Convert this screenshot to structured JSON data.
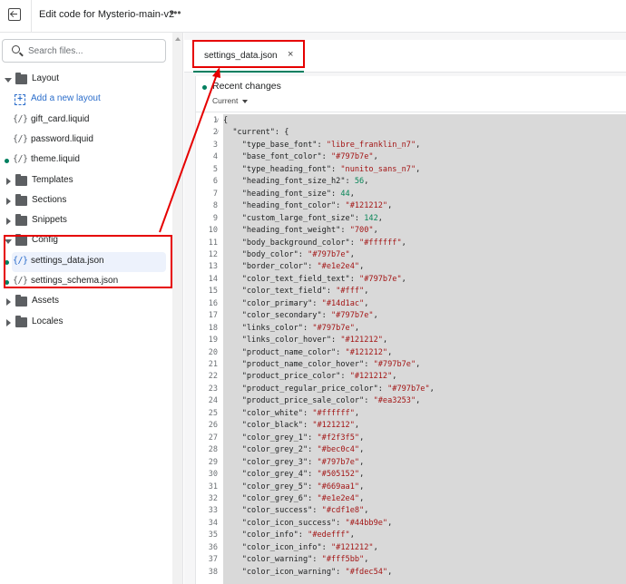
{
  "topbar": {
    "title": "Edit code for Mysterio-main-v2",
    "more_label": "•••",
    "back_icon": "exit-icon"
  },
  "sidebar": {
    "search_placeholder": "Search files...",
    "tree": [
      {
        "type": "folder",
        "label": "Layout",
        "expanded": true
      },
      {
        "type": "add",
        "label": "Add a new layout",
        "icon": "{+}"
      },
      {
        "type": "file",
        "label": "gift_card.liquid",
        "icon": "{/}",
        "modified": false
      },
      {
        "type": "file",
        "label": "password.liquid",
        "icon": "{/}",
        "modified": false
      },
      {
        "type": "file",
        "label": "theme.liquid",
        "icon": "{/}",
        "modified": true
      },
      {
        "type": "folder",
        "label": "Templates",
        "expanded": false
      },
      {
        "type": "folder",
        "label": "Sections",
        "expanded": false
      },
      {
        "type": "folder",
        "label": "Snippets",
        "expanded": false
      },
      {
        "type": "folder",
        "label": "Config",
        "expanded": true
      },
      {
        "type": "file",
        "label": "settings_data.json",
        "icon": "{/}",
        "modified": true,
        "selected": true
      },
      {
        "type": "file",
        "label": "settings_schema.json",
        "icon": "{/}",
        "modified": true
      },
      {
        "type": "folder",
        "label": "Assets",
        "expanded": false
      },
      {
        "type": "folder",
        "label": "Locales",
        "expanded": false
      }
    ]
  },
  "editor": {
    "tab": {
      "label": "settings_data.json",
      "close": "×"
    },
    "recent_changes": {
      "title": "Recent changes",
      "selected": "Current"
    },
    "lines": [
      [
        {
          "t": "{",
          "c": "k"
        }
      ],
      [
        {
          "t": "  \"current\": {",
          "c": "k"
        }
      ],
      [
        {
          "t": "    \"type_base_font\": ",
          "c": "k"
        },
        {
          "t": "\"libre_franklin_n7\"",
          "c": "s"
        },
        {
          "t": ",",
          "c": "k"
        }
      ],
      [
        {
          "t": "    \"base_font_color\": ",
          "c": "k"
        },
        {
          "t": "\"#797b7e\"",
          "c": "s"
        },
        {
          "t": ",",
          "c": "k"
        }
      ],
      [
        {
          "t": "    \"type_heading_font\": ",
          "c": "k"
        },
        {
          "t": "\"nunito_sans_n7\"",
          "c": "s"
        },
        {
          "t": ",",
          "c": "k"
        }
      ],
      [
        {
          "t": "    \"heading_font_size_h2\": ",
          "c": "k"
        },
        {
          "t": "56",
          "c": "n"
        },
        {
          "t": ",",
          "c": "k"
        }
      ],
      [
        {
          "t": "    \"heading_font_size\": ",
          "c": "k"
        },
        {
          "t": "44",
          "c": "n"
        },
        {
          "t": ",",
          "c": "k"
        }
      ],
      [
        {
          "t": "    \"heading_font_color\": ",
          "c": "k"
        },
        {
          "t": "\"#121212\"",
          "c": "s"
        },
        {
          "t": ",",
          "c": "k"
        }
      ],
      [
        {
          "t": "    \"custom_large_font_size\": ",
          "c": "k"
        },
        {
          "t": "142",
          "c": "n"
        },
        {
          "t": ",",
          "c": "k"
        }
      ],
      [
        {
          "t": "    \"heading_font_weight\": ",
          "c": "k"
        },
        {
          "t": "\"700\"",
          "c": "s"
        },
        {
          "t": ",",
          "c": "k"
        }
      ],
      [
        {
          "t": "    \"body_background_color\": ",
          "c": "k"
        },
        {
          "t": "\"#ffffff\"",
          "c": "s"
        },
        {
          "t": ",",
          "c": "k"
        }
      ],
      [
        {
          "t": "    \"body_color\": ",
          "c": "k"
        },
        {
          "t": "\"#797b7e\"",
          "c": "s"
        },
        {
          "t": ",",
          "c": "k"
        }
      ],
      [
        {
          "t": "    \"border_color\": ",
          "c": "k"
        },
        {
          "t": "\"#e1e2e4\"",
          "c": "s"
        },
        {
          "t": ",",
          "c": "k"
        }
      ],
      [
        {
          "t": "    \"color_text_field_text\": ",
          "c": "k"
        },
        {
          "t": "\"#797b7e\"",
          "c": "s"
        },
        {
          "t": ",",
          "c": "k"
        }
      ],
      [
        {
          "t": "    \"color_text_field\": ",
          "c": "k"
        },
        {
          "t": "\"#fff\"",
          "c": "s"
        },
        {
          "t": ",",
          "c": "k"
        }
      ],
      [
        {
          "t": "    \"color_primary\": ",
          "c": "k"
        },
        {
          "t": "\"#14d1ac\"",
          "c": "s"
        },
        {
          "t": ",",
          "c": "k"
        }
      ],
      [
        {
          "t": "    \"color_secondary\": ",
          "c": "k"
        },
        {
          "t": "\"#797b7e\"",
          "c": "s"
        },
        {
          "t": ",",
          "c": "k"
        }
      ],
      [
        {
          "t": "    \"links_color\": ",
          "c": "k"
        },
        {
          "t": "\"#797b7e\"",
          "c": "s"
        },
        {
          "t": ",",
          "c": "k"
        }
      ],
      [
        {
          "t": "    \"links_color_hover\": ",
          "c": "k"
        },
        {
          "t": "\"#121212\"",
          "c": "s"
        },
        {
          "t": ",",
          "c": "k"
        }
      ],
      [
        {
          "t": "    \"product_name_color\": ",
          "c": "k"
        },
        {
          "t": "\"#121212\"",
          "c": "s"
        },
        {
          "t": ",",
          "c": "k"
        }
      ],
      [
        {
          "t": "    \"product_name_color_hover\": ",
          "c": "k"
        },
        {
          "t": "\"#797b7e\"",
          "c": "s"
        },
        {
          "t": ",",
          "c": "k"
        }
      ],
      [
        {
          "t": "    \"product_price_color\": ",
          "c": "k"
        },
        {
          "t": "\"#121212\"",
          "c": "s"
        },
        {
          "t": ",",
          "c": "k"
        }
      ],
      [
        {
          "t": "    \"product_regular_price_color\": ",
          "c": "k"
        },
        {
          "t": "\"#797b7e\"",
          "c": "s"
        },
        {
          "t": ",",
          "c": "k"
        }
      ],
      [
        {
          "t": "    \"product_price_sale_color\": ",
          "c": "k"
        },
        {
          "t": "\"#ea3253\"",
          "c": "s"
        },
        {
          "t": ",",
          "c": "k"
        }
      ],
      [
        {
          "t": "    \"color_white\": ",
          "c": "k"
        },
        {
          "t": "\"#ffffff\"",
          "c": "s"
        },
        {
          "t": ",",
          "c": "k"
        }
      ],
      [
        {
          "t": "    \"color_black\": ",
          "c": "k"
        },
        {
          "t": "\"#121212\"",
          "c": "s"
        },
        {
          "t": ",",
          "c": "k"
        }
      ],
      [
        {
          "t": "    \"color_grey_1\": ",
          "c": "k"
        },
        {
          "t": "\"#f2f3f5\"",
          "c": "s"
        },
        {
          "t": ",",
          "c": "k"
        }
      ],
      [
        {
          "t": "    \"color_grey_2\": ",
          "c": "k"
        },
        {
          "t": "\"#bec0c4\"",
          "c": "s"
        },
        {
          "t": ",",
          "c": "k"
        }
      ],
      [
        {
          "t": "    \"color_grey_3\": ",
          "c": "k"
        },
        {
          "t": "\"#797b7e\"",
          "c": "s"
        },
        {
          "t": ",",
          "c": "k"
        }
      ],
      [
        {
          "t": "    \"color_grey_4\": ",
          "c": "k"
        },
        {
          "t": "\"#505152\"",
          "c": "s"
        },
        {
          "t": ",",
          "c": "k"
        }
      ],
      [
        {
          "t": "    \"color_grey_5\": ",
          "c": "k"
        },
        {
          "t": "\"#669aa1\"",
          "c": "s"
        },
        {
          "t": ",",
          "c": "k"
        }
      ],
      [
        {
          "t": "    \"color_grey_6\": ",
          "c": "k"
        },
        {
          "t": "\"#e1e2e4\"",
          "c": "s"
        },
        {
          "t": ",",
          "c": "k"
        }
      ],
      [
        {
          "t": "    \"color_success\": ",
          "c": "k"
        },
        {
          "t": "\"#cdf1e8\"",
          "c": "s"
        },
        {
          "t": ",",
          "c": "k"
        }
      ],
      [
        {
          "t": "    \"color_icon_success\": ",
          "c": "k"
        },
        {
          "t": "\"#44bb9e\"",
          "c": "s"
        },
        {
          "t": ",",
          "c": "k"
        }
      ],
      [
        {
          "t": "    \"color_info\": ",
          "c": "k"
        },
        {
          "t": "\"#edefff\"",
          "c": "s"
        },
        {
          "t": ",",
          "c": "k"
        }
      ],
      [
        {
          "t": "    \"color_icon_info\": ",
          "c": "k"
        },
        {
          "t": "\"#121212\"",
          "c": "s"
        },
        {
          "t": ",",
          "c": "k"
        }
      ],
      [
        {
          "t": "    \"color_warning\": ",
          "c": "k"
        },
        {
          "t": "\"#fff5bb\"",
          "c": "s"
        },
        {
          "t": ",",
          "c": "k"
        }
      ],
      [
        {
          "t": "    \"color_icon_warning\": ",
          "c": "k"
        },
        {
          "t": "\"#fdec54\"",
          "c": "s"
        },
        {
          "t": ",",
          "c": "k"
        }
      ]
    ],
    "foldable_lines": [
      1,
      2
    ]
  },
  "colors": {
    "accent_green": "#007f5f",
    "link_blue": "#2c6ecb",
    "annotation_red": "#e60000"
  }
}
